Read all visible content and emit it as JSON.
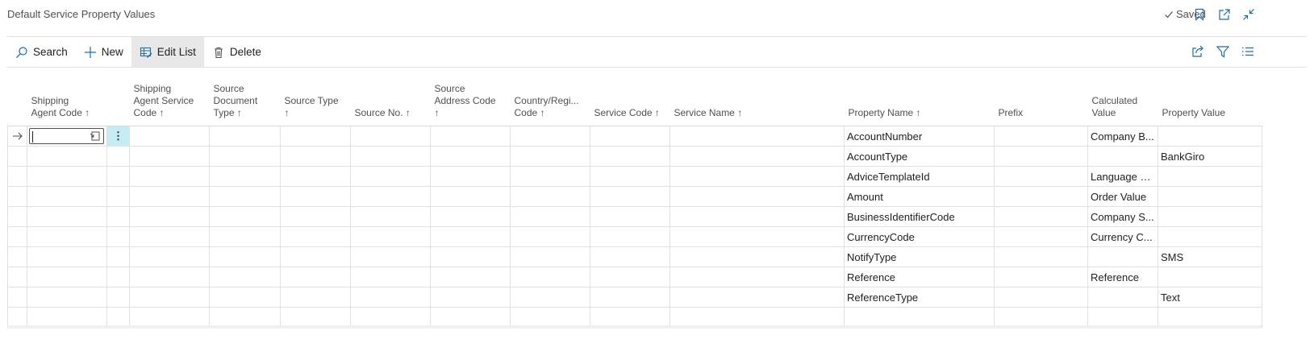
{
  "page": {
    "title": "Default Service Property Values",
    "status": "Saved"
  },
  "actions": {
    "search": "Search",
    "new": "New",
    "edit_list": "Edit List",
    "delete": "Delete"
  },
  "columns": [
    {
      "key": "shipping_agent_code",
      "label_lines": [
        "Shipping",
        "Agent Code ↑"
      ]
    },
    {
      "key": "shipping_agent_service_code",
      "label_lines": [
        "Shipping",
        "Agent Service",
        "Code ↑"
      ]
    },
    {
      "key": "source_document_type",
      "label_lines": [
        "Source",
        "Document",
        "Type ↑"
      ]
    },
    {
      "key": "source_type",
      "label_lines": [
        "Source Type",
        "↑"
      ]
    },
    {
      "key": "source_no",
      "label_lines": [
        "Source No. ↑"
      ]
    },
    {
      "key": "source_address_code",
      "label_lines": [
        "Source",
        "Address Code",
        "↑"
      ]
    },
    {
      "key": "country_region_code",
      "label_lines": [
        "Country/Regi...",
        "Code ↑"
      ]
    },
    {
      "key": "service_code",
      "label_lines": [
        "Service Code ↑"
      ]
    },
    {
      "key": "service_name",
      "label_lines": [
        "Service Name ↑"
      ]
    },
    {
      "key": "property_name",
      "label_lines": [
        "Property Name ↑"
      ]
    },
    {
      "key": "prefix",
      "label_lines": [
        "Prefix"
      ]
    },
    {
      "key": "calculated_value",
      "label_lines": [
        "Calculated",
        "Value"
      ]
    },
    {
      "key": "property_value",
      "label_lines": [
        "Property Value"
      ]
    }
  ],
  "rows": [
    {
      "property_name": "AccountNumber",
      "prefix": "",
      "calculated_value": "Company B...",
      "property_value": ""
    },
    {
      "property_name": "AccountType",
      "prefix": "",
      "calculated_value": "",
      "property_value": "BankGiro"
    },
    {
      "property_name": "AdviceTemplateId",
      "prefix": "",
      "calculated_value": "Language C...",
      "property_value": ""
    },
    {
      "property_name": "Amount",
      "prefix": "",
      "calculated_value": "Order Value",
      "property_value": ""
    },
    {
      "property_name": "BusinessIdentifierCode",
      "prefix": "",
      "calculated_value": "Company S...",
      "property_value": ""
    },
    {
      "property_name": "CurrencyCode",
      "prefix": "",
      "calculated_value": "Currency C...",
      "property_value": ""
    },
    {
      "property_name": "NotifyType",
      "prefix": "",
      "calculated_value": "",
      "property_value": "SMS"
    },
    {
      "property_name": "Reference",
      "prefix": "",
      "calculated_value": "Reference",
      "property_value": ""
    },
    {
      "property_name": "ReferenceType",
      "prefix": "",
      "calculated_value": "",
      "property_value": "Text"
    },
    {
      "property_name": "",
      "prefix": "",
      "calculated_value": "",
      "property_value": ""
    }
  ],
  "icons": {
    "saved": "checkmark-icon",
    "bookmark": "bookmark-icon",
    "open_new": "open-new-window-icon",
    "collapse": "collapse-icon",
    "share": "share-icon",
    "filter": "filter-icon",
    "list": "list-view-icon",
    "row_arrow": "row-indicator-arrow-icon",
    "lookup": "lookup-icon",
    "more": "more-options-icon"
  },
  "colors": {
    "accent": "#1c6ea4",
    "selected_cell": "#c6ecf3",
    "active_action": "#e8e8e8"
  }
}
